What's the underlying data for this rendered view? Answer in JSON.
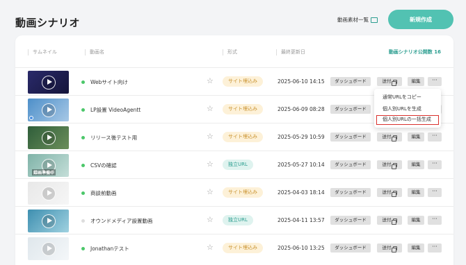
{
  "page": {
    "title": "動画シナリオ",
    "assets_link": "動画素材一覧",
    "new_button": "新規作成"
  },
  "table": {
    "headers": {
      "thumbnail": "サムネイル",
      "name": "動画名",
      "format": "形式",
      "updated": "最終更新日",
      "count": "動画シナリオ公開数 16"
    },
    "actions": {
      "dashboard": "ダッシュボード",
      "send": "送付",
      "edit": "編集",
      "more": "···"
    },
    "rows": [
      {
        "name": "Webサイト向け",
        "format": "サイト埋込み",
        "format_type": "site",
        "date": "2025-06-10 14:15",
        "status_color": "#4cc76a",
        "thumb_bg": "linear-gradient(135deg,#2a2a6a,#15153a)"
      },
      {
        "name": "LP設置 VideoAgentt",
        "format": "サイト埋込み",
        "format_type": "site",
        "date": "2025-06-09 08:28",
        "status_color": "#4cc76a",
        "thumb_bg": "linear-gradient(135deg,#4d8fc9,#a7c8e6)"
      },
      {
        "name": "リリース後テスト用",
        "format": "サイト埋込み",
        "format_type": "site",
        "date": "2025-05-29 10:59",
        "status_color": "#4cc76a",
        "thumb_bg": "linear-gradient(135deg,#2f5e3a,#6b8e5a)"
      },
      {
        "name": "CSVの確認",
        "format": "独立URL",
        "format_type": "url",
        "date": "2025-05-27 10:14",
        "status_color": "#4cc76a",
        "thumb_bg": "linear-gradient(135deg,#7fb3a8,#c4ded8)",
        "overlay": "録画準備中"
      },
      {
        "name": "商談前動画",
        "format": "サイト埋込み",
        "format_type": "site",
        "date": "2025-04-03 18:14",
        "status_color": "#4cc76a",
        "thumb_bg": "linear-gradient(135deg,#e8e8e8,#f6f6f6)"
      },
      {
        "name": "オウンドメディア設置動画",
        "format": "独立URL",
        "format_type": "url",
        "date": "2025-04-11 13:57",
        "status_color": "#dddddd",
        "thumb_bg": "linear-gradient(135deg,#3e8fb0,#9fd1e0)"
      },
      {
        "name": "Jonathanテスト",
        "format": "サイト埋込み",
        "format_type": "site",
        "date": "2025-06-10 13:25",
        "status_color": "#4cc76a",
        "thumb_bg": "linear-gradient(135deg,#dfe7ec,#f4f7f9)"
      }
    ]
  },
  "dropdown": {
    "items": [
      "通常URLをコピー",
      "個人別URLを生成",
      "個人別URLの一括生成"
    ]
  }
}
